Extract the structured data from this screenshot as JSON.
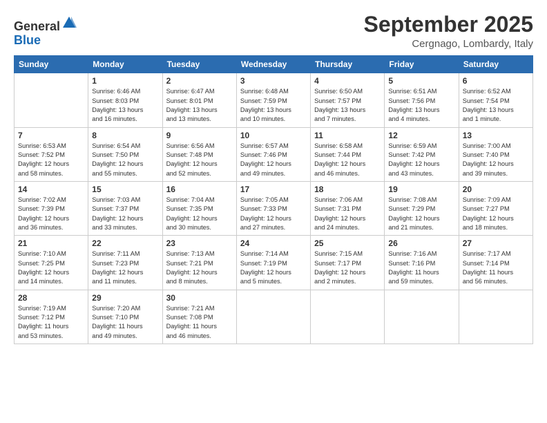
{
  "logo": {
    "general": "General",
    "blue": "Blue"
  },
  "header": {
    "month": "September 2025",
    "location": "Cergnago, Lombardy, Italy"
  },
  "days_of_week": [
    "Sunday",
    "Monday",
    "Tuesday",
    "Wednesday",
    "Thursday",
    "Friday",
    "Saturday"
  ],
  "weeks": [
    [
      {
        "day": "",
        "info": ""
      },
      {
        "day": "1",
        "info": "Sunrise: 6:46 AM\nSunset: 8:03 PM\nDaylight: 13 hours\nand 16 minutes."
      },
      {
        "day": "2",
        "info": "Sunrise: 6:47 AM\nSunset: 8:01 PM\nDaylight: 13 hours\nand 13 minutes."
      },
      {
        "day": "3",
        "info": "Sunrise: 6:48 AM\nSunset: 7:59 PM\nDaylight: 13 hours\nand 10 minutes."
      },
      {
        "day": "4",
        "info": "Sunrise: 6:50 AM\nSunset: 7:57 PM\nDaylight: 13 hours\nand 7 minutes."
      },
      {
        "day": "5",
        "info": "Sunrise: 6:51 AM\nSunset: 7:56 PM\nDaylight: 13 hours\nand 4 minutes."
      },
      {
        "day": "6",
        "info": "Sunrise: 6:52 AM\nSunset: 7:54 PM\nDaylight: 13 hours\nand 1 minute."
      }
    ],
    [
      {
        "day": "7",
        "info": "Sunrise: 6:53 AM\nSunset: 7:52 PM\nDaylight: 12 hours\nand 58 minutes."
      },
      {
        "day": "8",
        "info": "Sunrise: 6:54 AM\nSunset: 7:50 PM\nDaylight: 12 hours\nand 55 minutes."
      },
      {
        "day": "9",
        "info": "Sunrise: 6:56 AM\nSunset: 7:48 PM\nDaylight: 12 hours\nand 52 minutes."
      },
      {
        "day": "10",
        "info": "Sunrise: 6:57 AM\nSunset: 7:46 PM\nDaylight: 12 hours\nand 49 minutes."
      },
      {
        "day": "11",
        "info": "Sunrise: 6:58 AM\nSunset: 7:44 PM\nDaylight: 12 hours\nand 46 minutes."
      },
      {
        "day": "12",
        "info": "Sunrise: 6:59 AM\nSunset: 7:42 PM\nDaylight: 12 hours\nand 43 minutes."
      },
      {
        "day": "13",
        "info": "Sunrise: 7:00 AM\nSunset: 7:40 PM\nDaylight: 12 hours\nand 39 minutes."
      }
    ],
    [
      {
        "day": "14",
        "info": "Sunrise: 7:02 AM\nSunset: 7:39 PM\nDaylight: 12 hours\nand 36 minutes."
      },
      {
        "day": "15",
        "info": "Sunrise: 7:03 AM\nSunset: 7:37 PM\nDaylight: 12 hours\nand 33 minutes."
      },
      {
        "day": "16",
        "info": "Sunrise: 7:04 AM\nSunset: 7:35 PM\nDaylight: 12 hours\nand 30 minutes."
      },
      {
        "day": "17",
        "info": "Sunrise: 7:05 AM\nSunset: 7:33 PM\nDaylight: 12 hours\nand 27 minutes."
      },
      {
        "day": "18",
        "info": "Sunrise: 7:06 AM\nSunset: 7:31 PM\nDaylight: 12 hours\nand 24 minutes."
      },
      {
        "day": "19",
        "info": "Sunrise: 7:08 AM\nSunset: 7:29 PM\nDaylight: 12 hours\nand 21 minutes."
      },
      {
        "day": "20",
        "info": "Sunrise: 7:09 AM\nSunset: 7:27 PM\nDaylight: 12 hours\nand 18 minutes."
      }
    ],
    [
      {
        "day": "21",
        "info": "Sunrise: 7:10 AM\nSunset: 7:25 PM\nDaylight: 12 hours\nand 14 minutes."
      },
      {
        "day": "22",
        "info": "Sunrise: 7:11 AM\nSunset: 7:23 PM\nDaylight: 12 hours\nand 11 minutes."
      },
      {
        "day": "23",
        "info": "Sunrise: 7:13 AM\nSunset: 7:21 PM\nDaylight: 12 hours\nand 8 minutes."
      },
      {
        "day": "24",
        "info": "Sunrise: 7:14 AM\nSunset: 7:19 PM\nDaylight: 12 hours\nand 5 minutes."
      },
      {
        "day": "25",
        "info": "Sunrise: 7:15 AM\nSunset: 7:17 PM\nDaylight: 12 hours\nand 2 minutes."
      },
      {
        "day": "26",
        "info": "Sunrise: 7:16 AM\nSunset: 7:16 PM\nDaylight: 11 hours\nand 59 minutes."
      },
      {
        "day": "27",
        "info": "Sunrise: 7:17 AM\nSunset: 7:14 PM\nDaylight: 11 hours\nand 56 minutes."
      }
    ],
    [
      {
        "day": "28",
        "info": "Sunrise: 7:19 AM\nSunset: 7:12 PM\nDaylight: 11 hours\nand 53 minutes."
      },
      {
        "day": "29",
        "info": "Sunrise: 7:20 AM\nSunset: 7:10 PM\nDaylight: 11 hours\nand 49 minutes."
      },
      {
        "day": "30",
        "info": "Sunrise: 7:21 AM\nSunset: 7:08 PM\nDaylight: 11 hours\nand 46 minutes."
      },
      {
        "day": "",
        "info": ""
      },
      {
        "day": "",
        "info": ""
      },
      {
        "day": "",
        "info": ""
      },
      {
        "day": "",
        "info": ""
      }
    ]
  ]
}
